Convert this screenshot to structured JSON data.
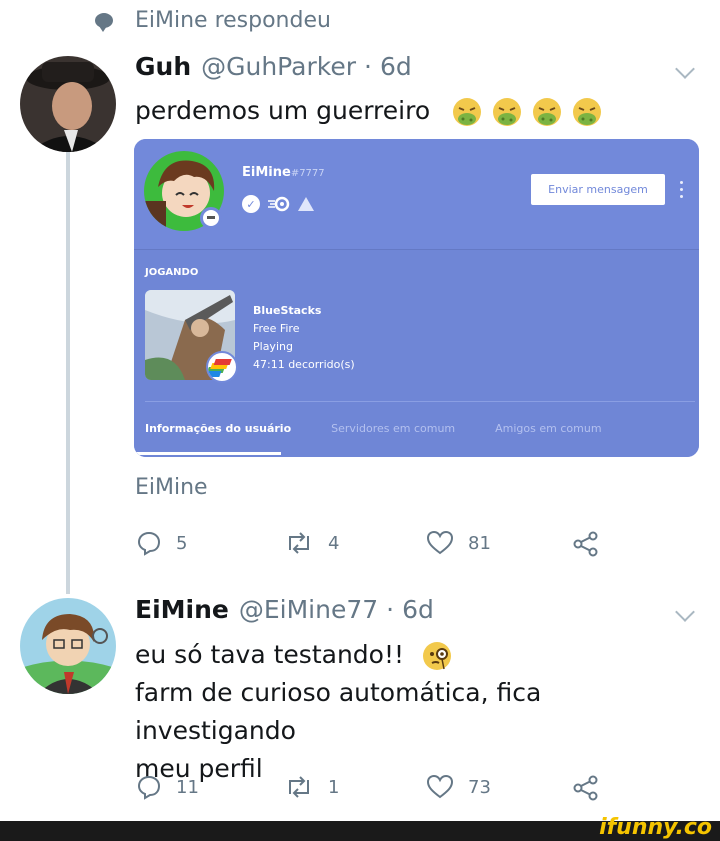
{
  "reply_header": {
    "text": "EiMine respondeu"
  },
  "tweet1": {
    "name": "Guh",
    "handle": "@GuhParker",
    "dot": "·",
    "time": "6d",
    "text": "perdemos um guerreiro",
    "emoji": [
      "nauseated-face",
      "nauseated-face",
      "nauseated-face",
      "nauseated-face"
    ],
    "card": {
      "username": "EiMine",
      "tag": "#7777",
      "button": "Enviar mensagem",
      "playing_label": "JOGANDO",
      "game_name": "BlueStacks",
      "game_detail": "Free Fire",
      "game_state": "Playing",
      "elapsed": "47:11 decorrido(s)",
      "tabs": [
        "Informações do usuário",
        "Servidores em comum",
        "Amigos em comum"
      ],
      "colors": {
        "blurple": "#7289da",
        "white": "#ffffff"
      }
    },
    "caption": "EiMine",
    "actions": {
      "replies": "5",
      "retweets": "4",
      "likes": "81"
    }
  },
  "tweet2": {
    "name": "EiMine",
    "handle": "@EiMine77",
    "dot": "·",
    "time": "6d",
    "line1": "eu só tava testando!!",
    "line1_emoji": "face-with-monocle",
    "line2": "farm de curioso automática, fica investigando",
    "line3": "meu perfil",
    "actions": {
      "replies": "11",
      "retweets": "1",
      "likes": "73"
    }
  },
  "footer": {
    "brand": "ifunny.co"
  },
  "colors": {
    "text": "#14171a",
    "muted": "#657786",
    "line": "#ccd6dd"
  }
}
